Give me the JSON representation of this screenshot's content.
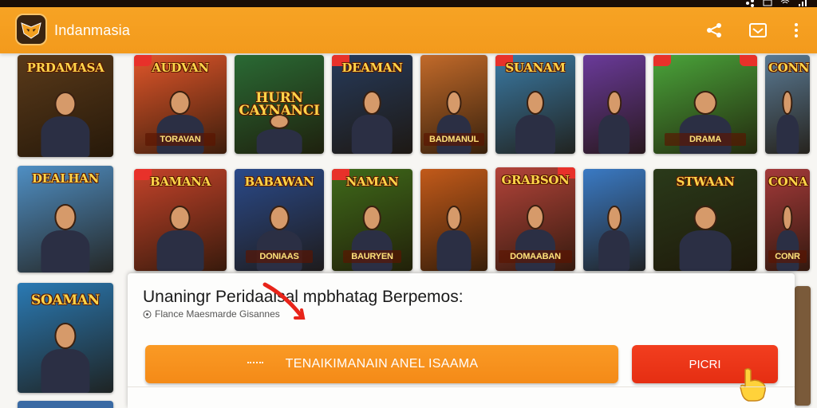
{
  "app": {
    "title": "Indanmasia",
    "accent": "#f39a1c",
    "status_icons": [
      "share-icon",
      "mail-icon",
      "wifi-icon",
      "signal-icon"
    ]
  },
  "toolbar": {
    "actions": [
      {
        "name": "share-icon"
      },
      {
        "name": "inbox-icon"
      },
      {
        "name": "more-vert-icon"
      }
    ]
  },
  "games": {
    "row1": [
      {
        "title": "PRDAMASA",
        "sub": "",
        "bg": "#5a3a1a"
      },
      {
        "title": "AUDVAN",
        "sub": "TORAVAN",
        "bg": "#e0562a"
      },
      {
        "title": "HURN CAYNANCI",
        "sub": "",
        "bg": "#2a6a34"
      },
      {
        "title": "DEAMAN",
        "sub": "",
        "bg": "#263a5a"
      },
      {
        "title": "",
        "sub": "BADMANUL",
        "bg": "#c26a2a"
      },
      {
        "title": "SUANAM",
        "sub": "",
        "bg": "#3a7aa4"
      },
      {
        "title": "",
        "sub": "",
        "bg": "#6a3a9a"
      },
      {
        "title": "",
        "sub": "DRAMA",
        "bg": "#4aa43a"
      },
      {
        "title": "CONN",
        "sub": "",
        "bg": "#5a7a94"
      }
    ],
    "row2": [
      {
        "title": "DEALHAN",
        "sub": "",
        "bg": "#4f8fc4"
      },
      {
        "title": "BAMANA",
        "sub": "",
        "bg": "#c4432a"
      },
      {
        "title": "BABAWAN",
        "sub": "DONIAAS",
        "bg": "#2a4a8a"
      },
      {
        "title": "NAMAN",
        "sub": "BAURYEN",
        "bg": "#3f6a1a"
      },
      {
        "title": "",
        "sub": "",
        "bg": "#c25a1a"
      },
      {
        "title": "GRABSON",
        "sub": "DOMAABAN",
        "bg": "#b4443a"
      },
      {
        "title": "",
        "sub": "",
        "bg": "#3a7ac4"
      },
      {
        "title": "STWAAN",
        "sub": "",
        "bg": "#2a3a1a"
      },
      {
        "title": "CONA",
        "sub": "CONR",
        "bg": "#a43a3a"
      }
    ],
    "row3": [
      {
        "title": "SOAMAN",
        "sub": "",
        "bg": "#2a7ab4"
      }
    ]
  },
  "panel": {
    "title": "Unaningr Peridaalsal mpbhatag Berpemos:",
    "subtitle": "Flance Maesmarde Gisannes",
    "primary_label": "TENAIKIMANAIN ANEL ISAAMA",
    "secondary_label": "PICRI"
  }
}
